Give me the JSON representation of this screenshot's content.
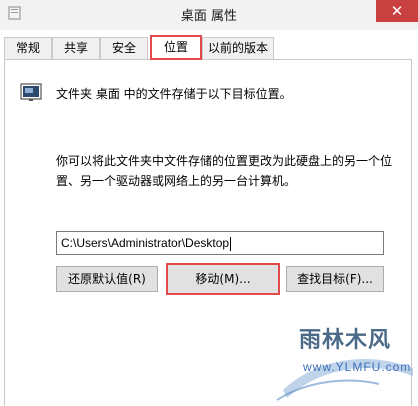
{
  "window": {
    "title": "桌面 属性",
    "close_glyph": "✕"
  },
  "tabs": [
    {
      "label": "常规",
      "active": false
    },
    {
      "label": "共享",
      "active": false
    },
    {
      "label": "安全",
      "active": false
    },
    {
      "label": "位置",
      "active": true
    },
    {
      "label": "以前的版本",
      "active": false
    }
  ],
  "location": {
    "description": "文件夹 桌面 中的文件存储于以下目标位置。",
    "help_text": "你可以将此文件夹中文件存储的位置更改为此硬盘上的另一个位置、另一个驱动器或网络上的另一台计算机。",
    "path_value": "C:\\Users\\Administrator\\Desktop"
  },
  "buttons": {
    "restore_default": "还原默认值(R)",
    "move": "移动(M)...",
    "find_target": "查找目标(F)..."
  },
  "watermark": {
    "brand": "雨林木风",
    "url": "www.YLMFU.com"
  },
  "colors": {
    "highlight_red": "#e24a4a",
    "close_red": "#c8403f",
    "watermark_blue": "#3d6fb8"
  }
}
